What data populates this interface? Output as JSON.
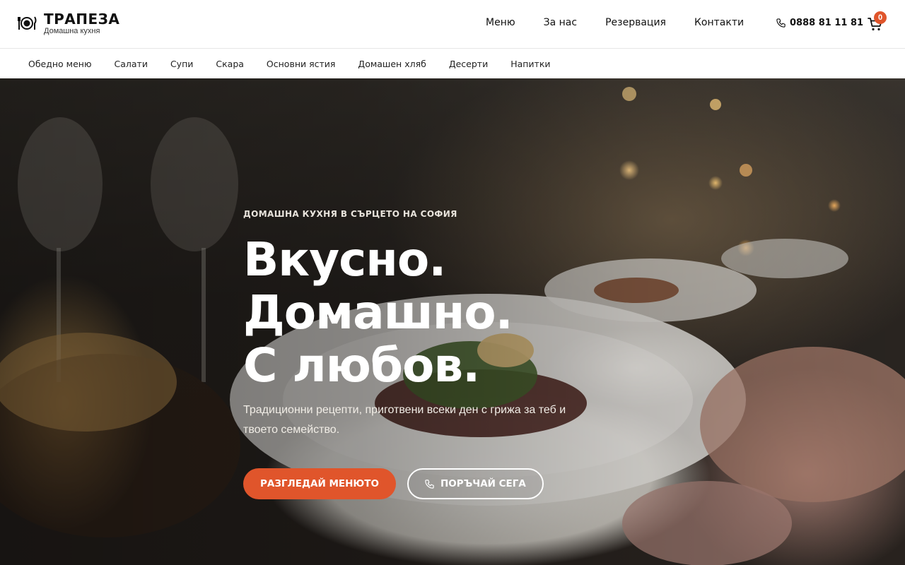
{
  "brand": {
    "title": "ТРАПЕЗА",
    "subtitle": "Домашна кухня"
  },
  "main_nav": [
    {
      "label": "Меню"
    },
    {
      "label": "За нас"
    },
    {
      "label": "Резервация"
    },
    {
      "label": "Контакти"
    }
  ],
  "phone": {
    "number": "0888 81 11 81",
    "icon": "phone-icon"
  },
  "cart": {
    "count": "0",
    "icon": "cart-icon"
  },
  "categories": [
    {
      "label": "Обедно меню"
    },
    {
      "label": "Салати"
    },
    {
      "label": "Супи"
    },
    {
      "label": "Скара"
    },
    {
      "label": "Основни ястия"
    },
    {
      "label": "Домашен хляб"
    },
    {
      "label": "Десерти"
    },
    {
      "label": "Напитки"
    }
  ],
  "hero": {
    "kicker": "ДОМАШНА КУХНЯ В СЪРЦЕТО НА СОФИЯ",
    "headline": [
      "Вкусно.",
      "Домашно.",
      "С любов."
    ],
    "lead": "Традиционни рецепти, приготвени всеки ден с грижа за теб и твоето семейство.",
    "primary_button": "РАЗГЛЕДАЙ МЕНЮТО",
    "secondary_button": "ПОРЪЧАЙ СЕГА"
  },
  "colors": {
    "accent": "#e0552b",
    "text": "#111111",
    "hero_text": "#ffffff"
  }
}
